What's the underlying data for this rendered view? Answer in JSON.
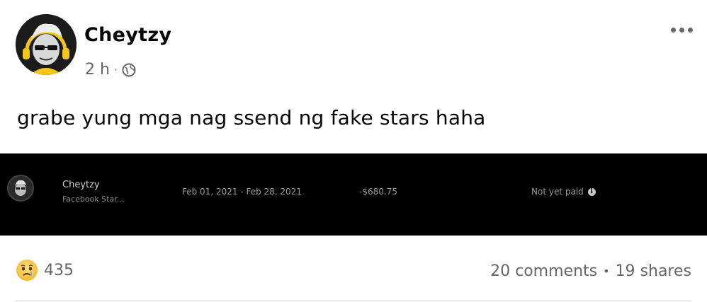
{
  "post": {
    "author": "Cheytzy",
    "time": "2 h",
    "separator": "·",
    "privacy_icon": "globe-icon",
    "text": "grabe yung mga nag ssend ng fake stars haha"
  },
  "payout": {
    "name": "Cheytzy",
    "subtitle": "Facebook Star...",
    "date_range": "Feb 01, 2021 - Feb 28, 2021",
    "amount": "-$680.75",
    "status": "Not yet paid",
    "status_icon": "info-icon"
  },
  "reactions": {
    "emoji": "sad-face-icon",
    "count": "435"
  },
  "engagement": {
    "comments": "20 comments",
    "separator": "•",
    "shares": "19 shares"
  },
  "colors": {
    "text_primary": "#050505",
    "text_secondary": "#65676b",
    "panel_background": "#000000",
    "avatar_accent": "#f5c518"
  }
}
